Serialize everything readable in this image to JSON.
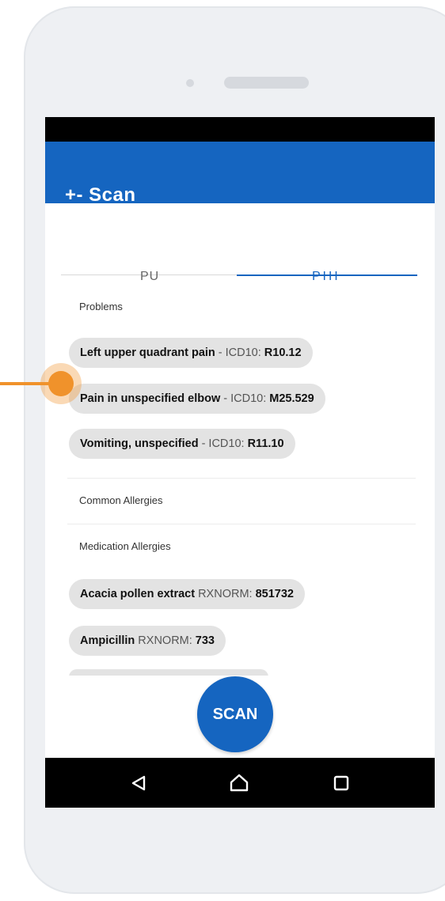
{
  "app": {
    "title": "+-  Scan"
  },
  "tabs": [
    {
      "label": "PU"
    },
    {
      "label": "PHI"
    }
  ],
  "problems": {
    "heading": "Problems",
    "items": [
      {
        "name": "Left upper quadrant pain",
        "code_label": "- ICD10:",
        "code": "R10.12"
      },
      {
        "name": "Pain in unspecified elbow",
        "code_label": "- ICD10:",
        "code": "M25.529"
      },
      {
        "name": "Vomiting, unspecified",
        "code_label": "- ICD10:",
        "code": "R11.10"
      }
    ]
  },
  "common_allergies": {
    "heading": "Common Allergies"
  },
  "medication_allergies": {
    "heading": "Medication Allergies",
    "items": [
      {
        "name": "Acacia pollen extract",
        "code_label": "RXNORM:",
        "code": "851732"
      },
      {
        "name": "Ampicillin",
        "code_label": "RXNORM:",
        "code": "733"
      }
    ]
  },
  "fab": {
    "label": "SCAN"
  },
  "colors": {
    "primary": "#1565c0",
    "accent_pointer": "#f0922b",
    "chip": "#e3e3e3"
  },
  "icons": {
    "back": "triangle-back-icon",
    "home": "home-icon",
    "recent": "square-recent-icon"
  }
}
